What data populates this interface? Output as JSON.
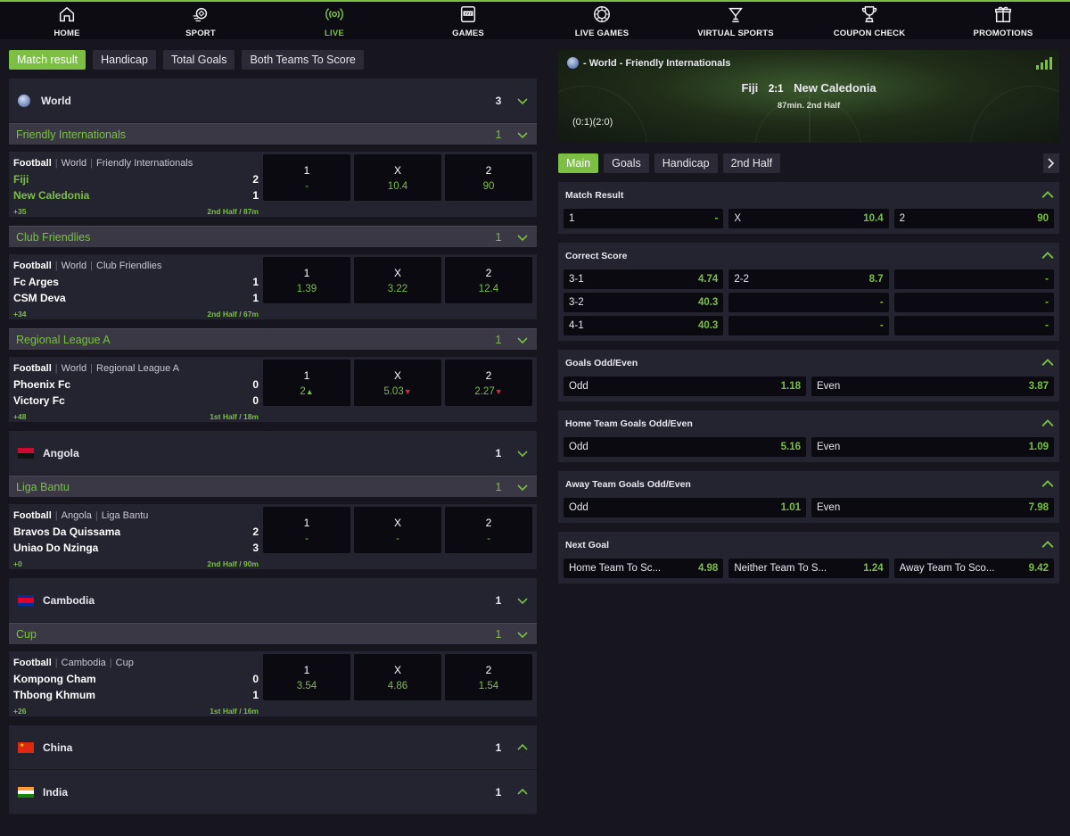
{
  "nav": [
    {
      "label": "HOME",
      "icon": "home-icon"
    },
    {
      "label": "SPORT",
      "icon": "sport-icon"
    },
    {
      "label": "LIVE",
      "icon": "live-icon",
      "active": true
    },
    {
      "label": "GAMES",
      "icon": "slot-icon"
    },
    {
      "label": "LIVE GAMES",
      "icon": "roulette-icon"
    },
    {
      "label": "VIRTUAL SPORTS",
      "icon": "virtual-sports-icon"
    },
    {
      "label": "COUPON CHECK",
      "icon": "trophy-icon"
    },
    {
      "label": "PROMOTIONS",
      "icon": "gift-icon"
    }
  ],
  "left_tabs": [
    "Match result",
    "Handicap",
    "Total Goals",
    "Both Teams To Score"
  ],
  "countries": [
    {
      "name": "World",
      "count": "3",
      "flag": "world",
      "expanded": true,
      "leagues": [
        {
          "name": "Friendly Internationals",
          "count": "1",
          "matches": [
            {
              "sport": "Football",
              "country": "World",
              "league": "Friendly Internationals",
              "home": "Fiji",
              "home_score": "2",
              "away": "New Caledonia",
              "away_score": "1",
              "highlight": true,
              "extra": "+35",
              "time": "2nd Half / 87m",
              "odds": [
                {
                  "label": "1",
                  "value": "-"
                },
                {
                  "label": "X",
                  "value": "10.4"
                },
                {
                  "label": "2",
                  "value": "90"
                }
              ]
            }
          ]
        },
        {
          "name": "Club Friendlies",
          "count": "1",
          "matches": [
            {
              "sport": "Football",
              "country": "World",
              "league": "Club Friendlies",
              "home": "Fc Arges",
              "home_score": "1",
              "away": "CSM Deva",
              "away_score": "1",
              "extra": "+34",
              "time": "2nd Half / 67m",
              "odds": [
                {
                  "label": "1",
                  "value": "1.39"
                },
                {
                  "label": "X",
                  "value": "3.22"
                },
                {
                  "label": "2",
                  "value": "12.4"
                }
              ]
            }
          ]
        },
        {
          "name": "Regional League A",
          "count": "1",
          "matches": [
            {
              "sport": "Football",
              "country": "World",
              "league": "Regional League A",
              "home": "Phoenix Fc",
              "home_score": "0",
              "away": "Victory Fc",
              "away_score": "0",
              "extra": "+48",
              "time": "1st Half / 18m",
              "odds": [
                {
                  "label": "1",
                  "value": "2",
                  "trend": "up"
                },
                {
                  "label": "X",
                  "value": "5.03",
                  "trend": "down"
                },
                {
                  "label": "2",
                  "value": "2.27",
                  "trend": "down"
                }
              ]
            }
          ]
        }
      ]
    },
    {
      "name": "Angola",
      "count": "1",
      "flag": "angola",
      "expanded": true,
      "leagues": [
        {
          "name": "Liga Bantu",
          "count": "1",
          "matches": [
            {
              "sport": "Football",
              "country": "Angola",
              "league": "Liga Bantu",
              "home": "Bravos Da Quissama",
              "home_score": "2",
              "away": "Uniao Do Nzinga",
              "away_score": "3",
              "extra": "+0",
              "time": "2nd Half / 90m",
              "odds": [
                {
                  "label": "1",
                  "value": "-"
                },
                {
                  "label": "X",
                  "value": "-"
                },
                {
                  "label": "2",
                  "value": "-"
                }
              ]
            }
          ]
        }
      ]
    },
    {
      "name": "Cambodia",
      "count": "1",
      "flag": "cambodia",
      "expanded": true,
      "leagues": [
        {
          "name": "Cup",
          "count": "1",
          "matches": [
            {
              "sport": "Football",
              "country": "Cambodia",
              "league": "Cup",
              "home": "Kompong Cham",
              "home_score": "0",
              "away": "Thbong Khmum",
              "away_score": "1",
              "extra": "+26",
              "time": "1st Half / 16m",
              "odds": [
                {
                  "label": "1",
                  "value": "3.54"
                },
                {
                  "label": "X",
                  "value": "4.86"
                },
                {
                  "label": "2",
                  "value": "1.54"
                }
              ]
            }
          ]
        }
      ]
    },
    {
      "name": "China",
      "count": "1",
      "flag": "china",
      "expanded": false,
      "leagues": []
    },
    {
      "name": "India",
      "count": "1",
      "flag": "india",
      "expanded": false,
      "leagues": []
    }
  ],
  "event": {
    "title": "- World - Friendly Internationals",
    "home": "Fiji",
    "score": "2:1",
    "away": "New Caledonia",
    "minute": "87min. 2nd Half",
    "halftime": "(0:1)(2:0)"
  },
  "right_tabs": [
    "Main",
    "Goals",
    "Handicap",
    "2nd Half"
  ],
  "markets": [
    {
      "title": "Match Result",
      "rows": [
        [
          {
            "l": "1",
            "v": "-"
          },
          {
            "l": "X",
            "v": "10.4"
          },
          {
            "l": "2",
            "v": "90"
          }
        ]
      ]
    },
    {
      "title": "Correct Score",
      "rows": [
        [
          {
            "l": "3-1",
            "v": "4.74"
          },
          {
            "l": "2-2",
            "v": "8.7"
          },
          {
            "l": "",
            "v": "-"
          }
        ],
        [
          {
            "l": "3-2",
            "v": "40.3"
          },
          {
            "l": "",
            "v": "-"
          },
          {
            "l": "",
            "v": "-"
          }
        ],
        [
          {
            "l": "4-1",
            "v": "40.3"
          },
          {
            "l": "",
            "v": "-"
          },
          {
            "l": "",
            "v": "-"
          }
        ]
      ]
    },
    {
      "title": "Goals Odd/Even",
      "rows": [
        [
          {
            "l": "Odd",
            "v": "1.18"
          },
          {
            "l": "Even",
            "v": "3.87"
          }
        ]
      ]
    },
    {
      "title": "Home Team Goals Odd/Even",
      "rows": [
        [
          {
            "l": "Odd",
            "v": "5.16"
          },
          {
            "l": "Even",
            "v": "1.09"
          }
        ]
      ]
    },
    {
      "title": "Away Team Goals Odd/Even",
      "rows": [
        [
          {
            "l": "Odd",
            "v": "1.01"
          },
          {
            "l": "Even",
            "v": "7.98"
          }
        ]
      ]
    },
    {
      "title": "Next Goal",
      "rows": [
        [
          {
            "l": "Home Team To Sc...",
            "v": "4.98"
          },
          {
            "l": "Neither Team To S...",
            "v": "1.24"
          },
          {
            "l": "Away Team To Sco...",
            "v": "9.42"
          }
        ]
      ]
    }
  ],
  "colors": {
    "accent": "#7bc043",
    "bg": "#17161f",
    "panel": "#242330",
    "league": "#393844",
    "cell": "#0b0a10",
    "down": "#e0223a"
  }
}
